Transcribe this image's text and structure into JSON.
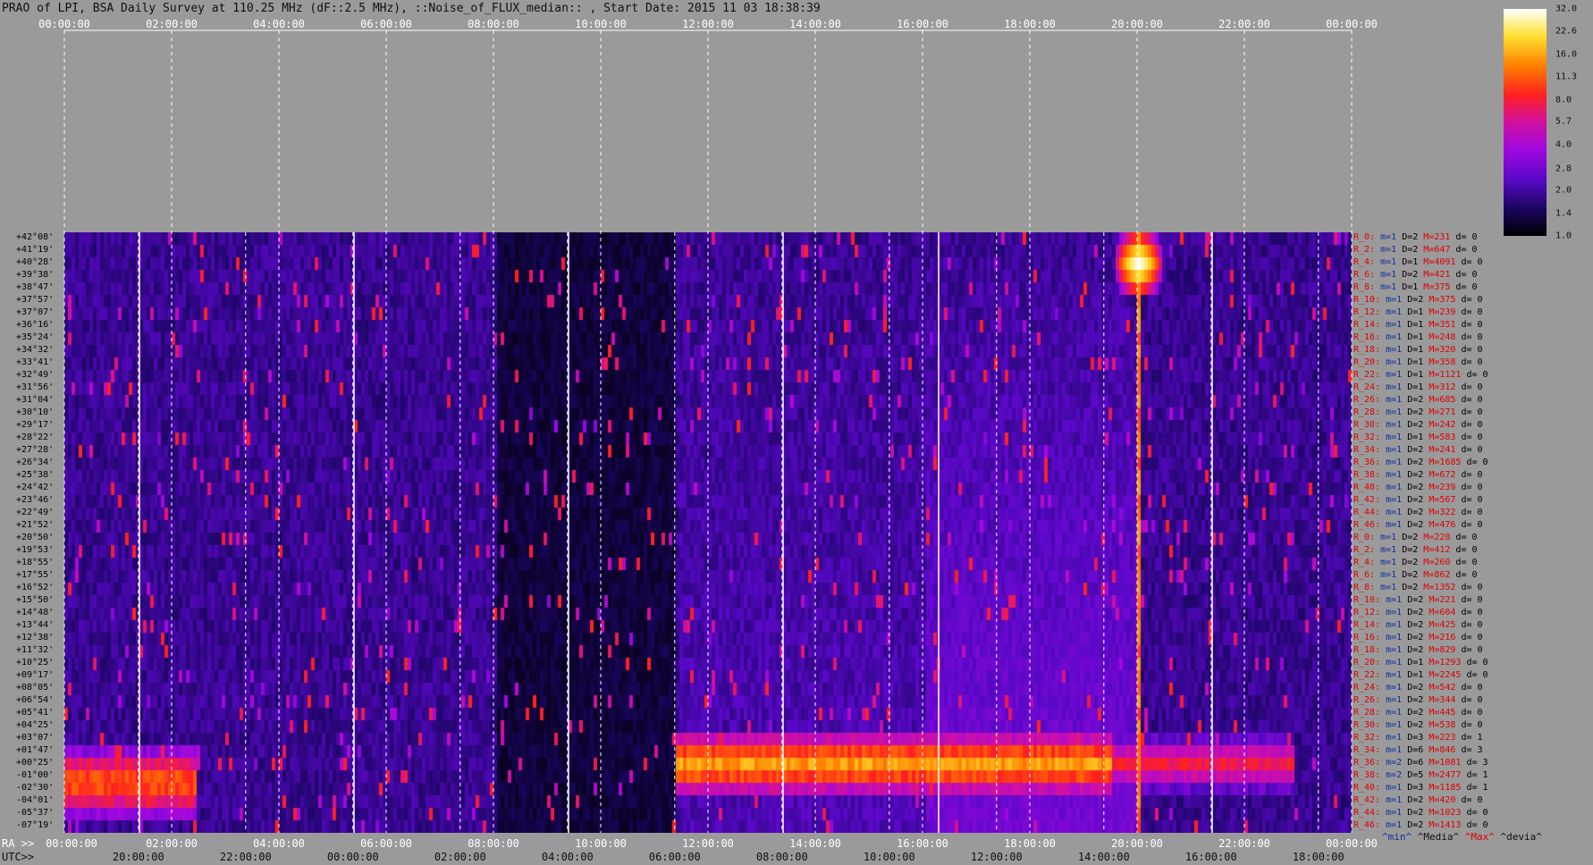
{
  "title": "PRAO of LPI, BSA Daily Survey at 110.25 MHz (dF::2.5 MHz), ::Noise_of_FLUX_median:: , Start Date: 2015 11 03 18:38:39",
  "top_ticks": [
    "00:00:00",
    "02:00:00",
    "04:00:00",
    "06:00:00",
    "08:00:00",
    "10:00:00",
    "12:00:00",
    "14:00:00",
    "16:00:00",
    "18:00:00",
    "20:00:00",
    "22:00:00",
    "00:00:00"
  ],
  "ra_prefix": "RA >>",
  "utc_prefix": "UTC>>",
  "ra_ticks": [
    "00:00:00",
    "02:00:00",
    "04:00:00",
    "06:00:00",
    "08:00:00",
    "10:00:00",
    "12:00:00",
    "14:00:00",
    "16:00:00",
    "18:00:00",
    "20:00:00",
    "22:00:00",
    "00:00:00"
  ],
  "utc_ticks": [
    "20:00:00",
    "22:00:00",
    "00:00:00",
    "02:00:00",
    "04:00:00",
    "06:00:00",
    "08:00:00",
    "10:00:00",
    "12:00:00",
    "14:00:00",
    "16:00:00",
    "18:00:00"
  ],
  "declinations": [
    "+42°08'",
    "+41°19'",
    "+40°28'",
    "+39°38'",
    "+38°47'",
    "+37°57'",
    "+37°07'",
    "+36°16'",
    "+35°24'",
    "+34°32'",
    "+33°41'",
    "+32°49'",
    "+31°56'",
    "+31°04'",
    "+30°10'",
    "+29°17'",
    "+28°22'",
    "+27°28'",
    "+26°34'",
    "+25°38'",
    "+24°42'",
    "+23°46'",
    "+22°49'",
    "+21°52'",
    "+20°50'",
    "+19°53'",
    "+18°55'",
    "+17°55'",
    "+16°52'",
    "+15°50'",
    "+14°48'",
    "+13°44'",
    "+12°38'",
    "+11°32'",
    "+10°25'",
    "+09°17'",
    "+08°05'",
    "+06°54'",
    "+05°41'",
    "+04°25'",
    "+03°07'",
    "+01°47'",
    "+00°25'",
    "-01°00'",
    "-02°30'",
    "-04°01'",
    "-05°37'",
    "-07°19'"
  ],
  "stat_rows": [
    {
      "n": "R_0:",
      "m": "m=1",
      "d": "D=2",
      "mx": "M=231",
      "dv": "d= 0"
    },
    {
      "n": "R_2:",
      "m": "m=1",
      "d": "D=2",
      "mx": "M=647",
      "dv": "d= 0"
    },
    {
      "n": "R_4:",
      "m": "m=1",
      "d": "D=1",
      "mx": "M=4091",
      "dv": "d= 0"
    },
    {
      "n": "R_6:",
      "m": "m=1",
      "d": "D=2",
      "mx": "M=421",
      "dv": "d= 0"
    },
    {
      "n": "R_8:",
      "m": "m=1",
      "d": "D=1",
      "mx": "M=375",
      "dv": "d= 0"
    },
    {
      "n": "R_10:",
      "m": "m=1",
      "d": "D=2",
      "mx": "M=375",
      "dv": "d= 0"
    },
    {
      "n": "R_12:",
      "m": "m=1",
      "d": "D=1",
      "mx": "M=239",
      "dv": "d= 0"
    },
    {
      "n": "R_14:",
      "m": "m=1",
      "d": "D=1",
      "mx": "M=351",
      "dv": "d= 0"
    },
    {
      "n": "R_16:",
      "m": "m=1",
      "d": "D=1",
      "mx": "M=248",
      "dv": "d= 0"
    },
    {
      "n": "R_18:",
      "m": "m=1",
      "d": "D=1",
      "mx": "M=320",
      "dv": "d= 0"
    },
    {
      "n": "R_20:",
      "m": "m=1",
      "d": "D=1",
      "mx": "M=358",
      "dv": "d= 0"
    },
    {
      "n": "R_22:",
      "m": "m=1",
      "d": "D=1",
      "mx": "M=1121",
      "dv": "d= 0"
    },
    {
      "n": "R_24:",
      "m": "m=1",
      "d": "D=1",
      "mx": "M=312",
      "dv": "d= 0"
    },
    {
      "n": "R_26:",
      "m": "m=1",
      "d": "D=2",
      "mx": "M=685",
      "dv": "d= 0"
    },
    {
      "n": "R_28:",
      "m": "m=1",
      "d": "D=2",
      "mx": "M=271",
      "dv": "d= 0"
    },
    {
      "n": "R_30:",
      "m": "m=1",
      "d": "D=2",
      "mx": "M=242",
      "dv": "d= 0"
    },
    {
      "n": "R_32:",
      "m": "m=1",
      "d": "D=1",
      "mx": "M=583",
      "dv": "d= 0"
    },
    {
      "n": "R_34:",
      "m": "m=1",
      "d": "D=2",
      "mx": "M=241",
      "dv": "d= 0"
    },
    {
      "n": "R_36:",
      "m": "m=1",
      "d": "D=2",
      "mx": "M=1685",
      "dv": "d= 0"
    },
    {
      "n": "R_38:",
      "m": "m=1",
      "d": "D=2",
      "mx": "M=672",
      "dv": "d= 0"
    },
    {
      "n": "R_40:",
      "m": "m=1",
      "d": "D=2",
      "mx": "M=239",
      "dv": "d= 0"
    },
    {
      "n": "R_42:",
      "m": "m=1",
      "d": "D=2",
      "mx": "M=567",
      "dv": "d= 0"
    },
    {
      "n": "R_44:",
      "m": "m=1",
      "d": "D=2",
      "mx": "M=322",
      "dv": "d= 0"
    },
    {
      "n": "R_46:",
      "m": "m=1",
      "d": "D=2",
      "mx": "M=476",
      "dv": "d= 0"
    },
    {
      "n": "R_0:",
      "m": "m=1",
      "d": "D=2",
      "mx": "M=228",
      "dv": "d= 0"
    },
    {
      "n": "R_2:",
      "m": "m=1",
      "d": "D=2",
      "mx": "M=412",
      "dv": "d= 0"
    },
    {
      "n": "R_4:",
      "m": "m=1",
      "d": "D=2",
      "mx": "M=260",
      "dv": "d= 0"
    },
    {
      "n": "R_6:",
      "m": "m=1",
      "d": "D=2",
      "mx": "M=862",
      "dv": "d= 0"
    },
    {
      "n": "R_8:",
      "m": "m=1",
      "d": "D=2",
      "mx": "M=1352",
      "dv": "d= 0"
    },
    {
      "n": "R_10:",
      "m": "m=1",
      "d": "D=2",
      "mx": "M=221",
      "dv": "d= 0"
    },
    {
      "n": "R_12:",
      "m": "m=1",
      "d": "D=2",
      "mx": "M=604",
      "dv": "d= 0"
    },
    {
      "n": "R_14:",
      "m": "m=1",
      "d": "D=2",
      "mx": "M=425",
      "dv": "d= 0"
    },
    {
      "n": "R_16:",
      "m": "m=1",
      "d": "D=2",
      "mx": "M=216",
      "dv": "d= 0"
    },
    {
      "n": "R_18:",
      "m": "m=1",
      "d": "D=2",
      "mx": "M=829",
      "dv": "d= 0"
    },
    {
      "n": "R_20:",
      "m": "m=1",
      "d": "D=1",
      "mx": "M=1293",
      "dv": "d= 0"
    },
    {
      "n": "R_22:",
      "m": "m=1",
      "d": "D=1",
      "mx": "M=2245",
      "dv": "d= 0"
    },
    {
      "n": "R_24:",
      "m": "m=1",
      "d": "D=2",
      "mx": "M=542",
      "dv": "d= 0"
    },
    {
      "n": "R_26:",
      "m": "m=1",
      "d": "D=2",
      "mx": "M=344",
      "dv": "d= 0"
    },
    {
      "n": "R_28:",
      "m": "m=1",
      "d": "D=2",
      "mx": "M=445",
      "dv": "d= 0"
    },
    {
      "n": "R_30:",
      "m": "m=1",
      "d": "D=2",
      "mx": "M=538",
      "dv": "d= 0"
    },
    {
      "n": "R_32:",
      "m": "m=1",
      "d": "D=3",
      "mx": "M=223",
      "dv": "d= 1"
    },
    {
      "n": "R_34:",
      "m": "m=1",
      "d": "D=6",
      "mx": "M=846",
      "dv": "d= 3"
    },
    {
      "n": "R_36:",
      "m": "m=2",
      "d": "D=6",
      "mx": "M=1081",
      "dv": "d= 3"
    },
    {
      "n": "R_38:",
      "m": "m=2",
      "d": "D=5",
      "mx": "M=2477",
      "dv": "d= 1"
    },
    {
      "n": "R_40:",
      "m": "m=1",
      "d": "D=3",
      "mx": "M=1185",
      "dv": "d= 1"
    },
    {
      "n": "R_42:",
      "m": "m=1",
      "d": "D=2",
      "mx": "M=420",
      "dv": "d= 0"
    },
    {
      "n": "R_44:",
      "m": "m=1",
      "d": "D=2",
      "mx": "M=1023",
      "dv": "d= 0"
    },
    {
      "n": "R_46:",
      "m": "m=1",
      "d": "D=2",
      "mx": "M=1413",
      "dv": "d= 0"
    }
  ],
  "legend_bottom": {
    "min": "^min^",
    "median": "^Media^",
    "max": "^Max^",
    "dev": "^devia^"
  },
  "colorbar_labels": [
    "32.0",
    "22.6",
    "16.0",
    "11.3",
    "8.0",
    "5.7",
    "4.0",
    "2.8",
    "2.0",
    "1.4",
    "1.0"
  ],
  "chart_data": {
    "type": "heatmap",
    "title": "PRAO of LPI, BSA Daily Survey at 110.25 MHz (dF::2.5 MHz), ::Noise_of_FLUX_median:: , Start Date: 2015 11 03 18:38:39",
    "x_axis": "RA 00:00:00 to 24:00:00",
    "x_secondary": "UTC 18:38:39 start",
    "y_categories": "declinations",
    "colorbar": {
      "min": 1.0,
      "max": 32.0,
      "scale": "log2"
    },
    "colormap": [
      "#000000",
      "#1a0560",
      "#5a08c8",
      "#a008e0",
      "#d010a0",
      "#ff2020",
      "#ff8000",
      "#ffe030",
      "#ffffff"
    ],
    "n_rows": 48,
    "features": [
      {
        "kind": "band",
        "ra_start_h": 0.0,
        "ra_end_h": 2.4,
        "dec_rows": [
          41,
          46
        ],
        "level": 14
      },
      {
        "kind": "band",
        "ra_start_h": 11.4,
        "ra_end_h": 19.5,
        "dec_rows": [
          40,
          44
        ],
        "level": 18
      },
      {
        "kind": "band",
        "ra_start_h": 19.5,
        "ra_end_h": 22.9,
        "dec_rows": [
          40,
          44
        ],
        "level": 9
      },
      {
        "kind": "source",
        "ra_h": 20.0,
        "dec_row": 2,
        "level": 32
      },
      {
        "kind": "ridge",
        "ra_h": 20.0,
        "dec_rows": [
          0,
          47
        ],
        "level": 16
      }
    ]
  }
}
